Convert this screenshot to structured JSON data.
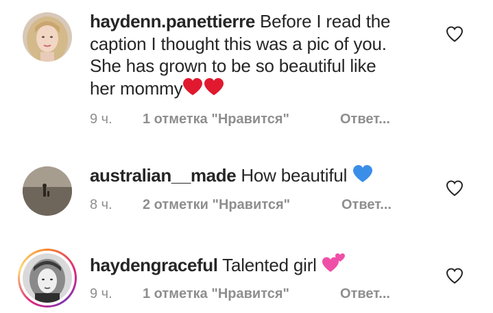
{
  "comments": [
    {
      "username": "haydenn.panettierre",
      "line1": "Before I read the",
      "line2": "caption I thought this was a pic of you.",
      "line3": "She has grown to be so beautiful like",
      "line4": "her mommy",
      "emoji": "❤❤",
      "time": "9 ч.",
      "likes": "1 отметка \"Нравится\"",
      "reply": "Ответ..."
    },
    {
      "username": "australian__made",
      "text": "How beautiful",
      "emoji": "💙",
      "time": "8 ч.",
      "likes": "2 отметки \"Нравится\"",
      "reply": "Ответ..."
    },
    {
      "username": "haydengraceful",
      "text": "Talented girl",
      "emoji": "💕",
      "time": "9 ч.",
      "likes": "1 отметка \"Нравится\"",
      "reply": "Ответ..."
    }
  ],
  "icons": {
    "like": "heart-outline-icon",
    "like_color": "#262626",
    "heart_emoji_color": "#e0192f",
    "blue_heart_color": "#3b8ee8",
    "pink_hearts_color": "#f04fa7",
    "story_ring_colors": [
      "#f58529",
      "#dd2a7b",
      "#8134af",
      "#feda77"
    ]
  },
  "colors": {
    "text": "#262626",
    "meta": "#8e8e8e"
  }
}
